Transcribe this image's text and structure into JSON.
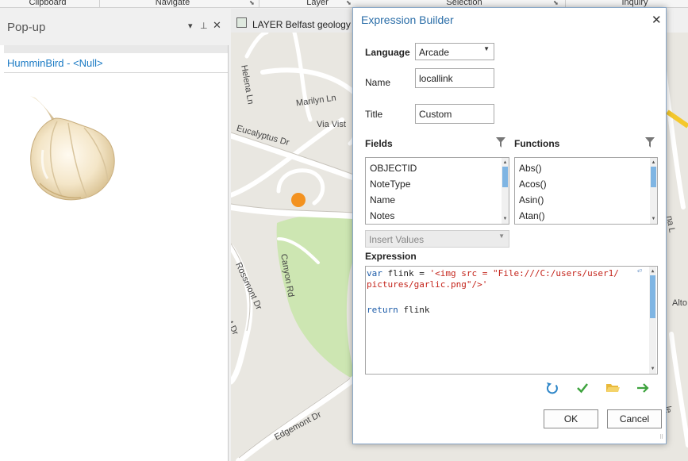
{
  "ribbon": {
    "groups": [
      "Clipboard",
      "Navigate",
      "Layer",
      "Selection",
      "Inquiry"
    ]
  },
  "popup": {
    "title": "Pop-up",
    "feature_title": "HumminBird - <Null>",
    "image_icon": "garlic-icon"
  },
  "map": {
    "tab_label": "LAYER Belfast geology",
    "streets": [
      "Helena Ln",
      "Marilyn Ln",
      "Via Vist",
      "Eucalyptus Dr",
      "Canyon Rd",
      "Rossmont Dr",
      "Edgemont Dr",
      "t Dr",
      "na L",
      "le",
      "Alto"
    ],
    "colors": {
      "park": "#cde6b2",
      "road": "#ffffff",
      "accent_point": "#f39220",
      "highway": "#f4c82d"
    }
  },
  "dialog": {
    "title": "Expression Builder",
    "language_label": "Language",
    "language_value": "Arcade",
    "name_label": "Name",
    "name_value": "locallink",
    "title_label": "Title",
    "title_value": "Custom",
    "fields_label": "Fields",
    "functions_label": "Functions",
    "fields": [
      "OBJECTID",
      "NoteType",
      "Name",
      "Notes"
    ],
    "functions": [
      "Abs()",
      "Acos()",
      "Asin()",
      "Atan()"
    ],
    "insert_values": "Insert Values",
    "expression_label": "Expression",
    "code": {
      "line1_kw": "var",
      "line1_plain": " flink = ",
      "line1_str": "'<img src = \"File:///C:/users/user1/",
      "line2_str": "pictures/garlic.png\"/>'",
      "line4_kw": "return",
      "line4_plain": " flink"
    },
    "ok_label": "OK",
    "cancel_label": "Cancel",
    "colors": {
      "title": "#2b6ea8",
      "keyword": "#1a5aa8",
      "string": "#c4241b",
      "scroll_thumb": "#7fb5e3"
    }
  }
}
